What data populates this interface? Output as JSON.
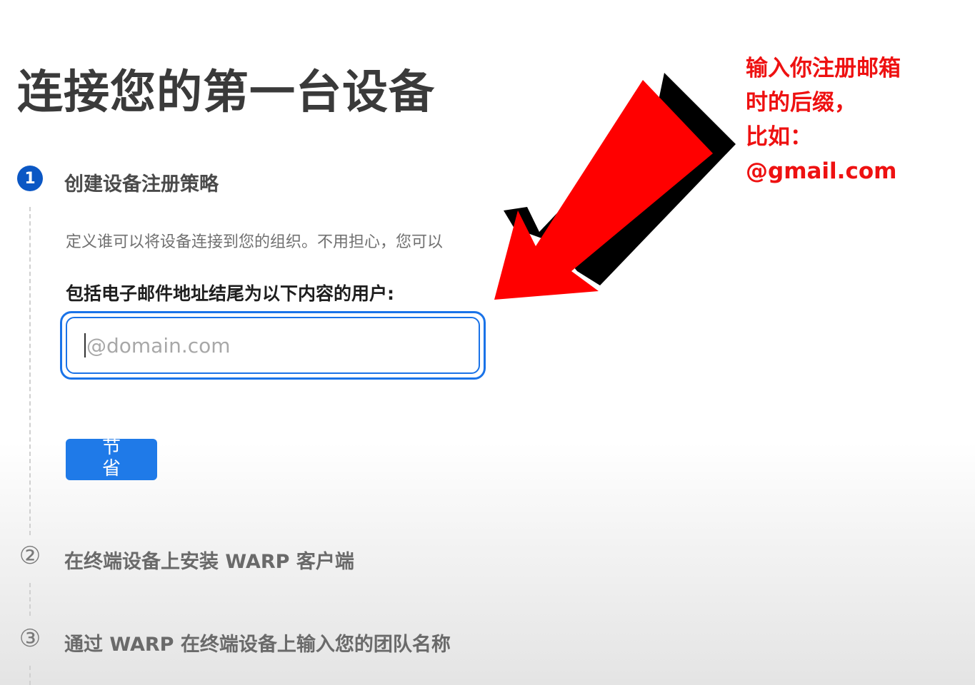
{
  "page": {
    "title": "连接您的第一台设备"
  },
  "steps": [
    {
      "number": "1",
      "label": "创建设备注册策略",
      "state": "active"
    },
    {
      "number": "②",
      "label": "在终端设备上安装 WARP 客户端",
      "state": "inactive"
    },
    {
      "number": "③",
      "label": "通过 WARP 在终端设备上输入您的团队名称",
      "state": "inactive"
    }
  ],
  "step1": {
    "description": "定义谁可以将设备连接到您的组织。不用担心，您可以",
    "description_tail": "。",
    "field_label": "包括电子邮件地址结尾为以下内容的用户:",
    "email_input": {
      "value": "",
      "placeholder": "@domain.com"
    },
    "save_label": "节省"
  },
  "annotation": {
    "lines": [
      "输入你注册邮箱",
      "时的后缀，",
      "比如：",
      "@gmail.com"
    ],
    "color": "#ee1111",
    "arrow_color": "#ff0000",
    "arrow_shadow_color": "#000000"
  }
}
